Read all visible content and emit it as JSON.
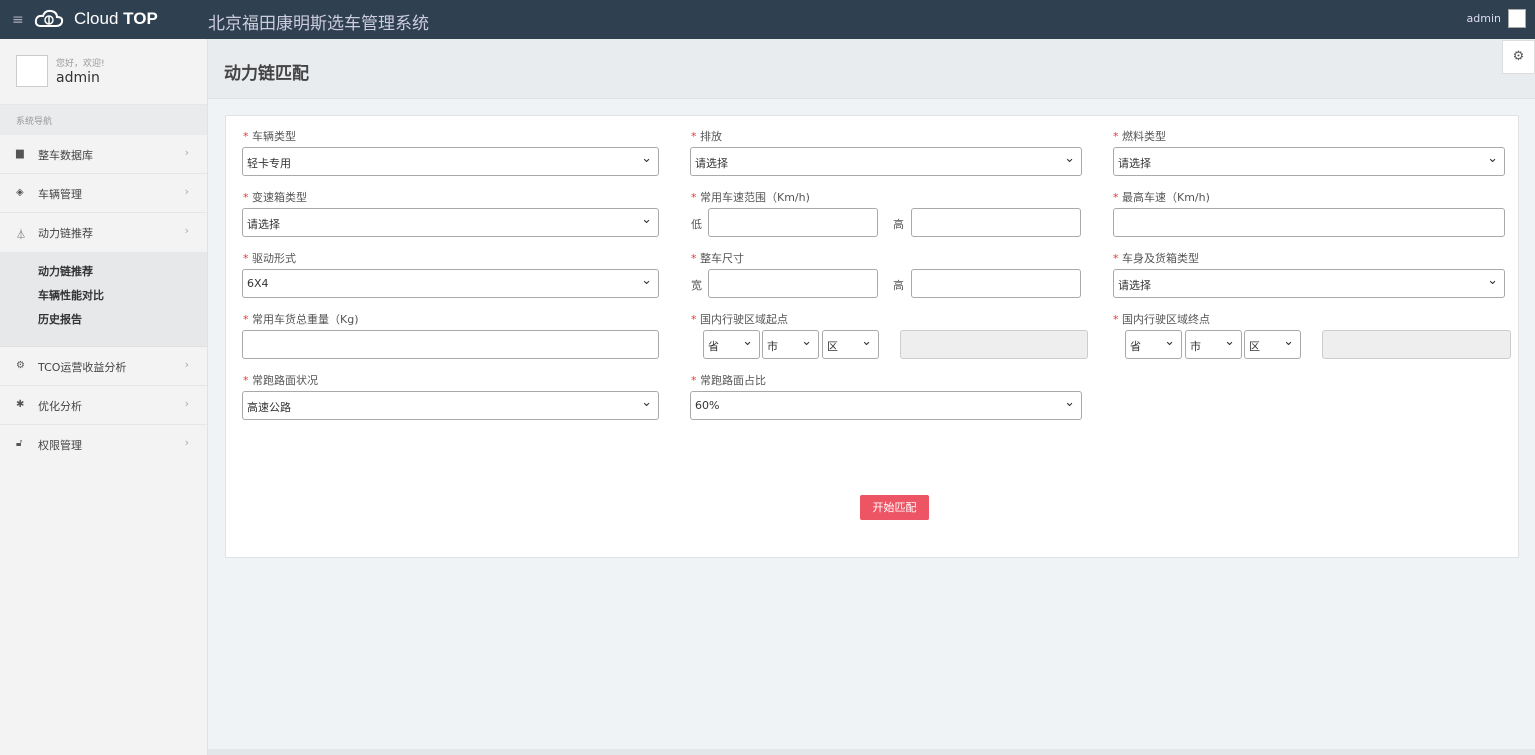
{
  "header": {
    "brand_light": "Cloud",
    "brand_bold": "TOP",
    "system_title": "北京福田康明斯选车管理系统",
    "user": "admin"
  },
  "sidebar": {
    "greeting": "您好，欢迎!",
    "username": "admin",
    "nav_header": "系统导航",
    "items": [
      {
        "label": "整车数据库",
        "icon": "database-icon"
      },
      {
        "label": "车辆管理",
        "icon": "cube-icon"
      },
      {
        "label": "动力链推荐",
        "icon": "flask-icon"
      },
      {
        "label": "TCO运营收益分析",
        "icon": "cogs-icon"
      },
      {
        "label": "优化分析",
        "icon": "gear-icon"
      },
      {
        "label": "权限管理",
        "icon": "unlock-icon"
      }
    ],
    "submenu": [
      "动力链推荐",
      "车辆性能对比",
      "历史报告"
    ]
  },
  "page": {
    "title": "动力链匹配"
  },
  "form": {
    "vehicle_type": {
      "label": "车辆类型",
      "value": "轻卡专用"
    },
    "emission": {
      "label": "排放",
      "value": "请选择"
    },
    "fuel_type": {
      "label": "燃料类型",
      "value": "请选择"
    },
    "gearbox_type": {
      "label": "变速箱类型",
      "value": "请选择"
    },
    "speed_range": {
      "label": "常用车速范围（Km/h)",
      "low": "低",
      "high": "高"
    },
    "max_speed": {
      "label": "最高车速（Km/h)"
    },
    "drive_form": {
      "label": "驱动形式",
      "value": "6X4"
    },
    "vehicle_size": {
      "label": "整车尺寸",
      "width": "宽",
      "height": "高"
    },
    "body_type": {
      "label": "车身及货箱类型",
      "value": "请选择"
    },
    "gross_weight": {
      "label": "常用车货总重量（Kg)"
    },
    "origin": {
      "label": "国内行驶区域起点",
      "province": "省",
      "city": "市",
      "district": "区"
    },
    "destination": {
      "label": "国内行驶区域终点",
      "province": "省",
      "city": "市",
      "district": "区"
    },
    "road_condition": {
      "label": "常跑路面状况",
      "value": "高速公路"
    },
    "road_ratio": {
      "label": "常跑路面占比",
      "value": "60%"
    },
    "required_mark": "*",
    "submit": "开始匹配"
  }
}
